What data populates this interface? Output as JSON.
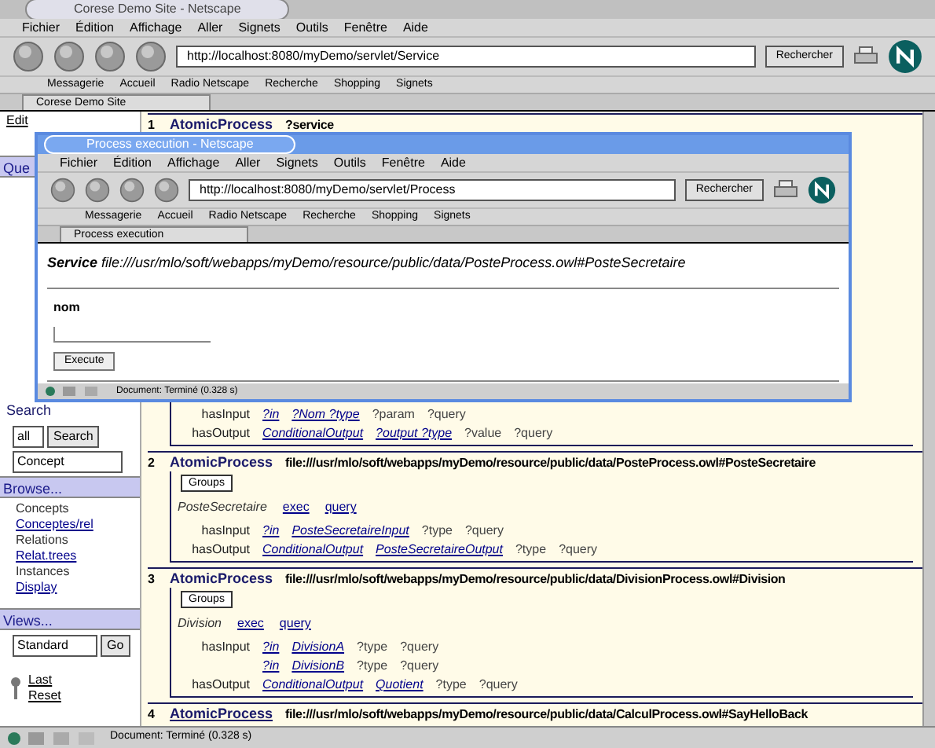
{
  "window": {
    "title": "Corese Demo Site - Netscape"
  },
  "menu": [
    "Fichier",
    "Édition",
    "Affichage",
    "Aller",
    "Signets",
    "Outils",
    "Fenêtre",
    "Aide"
  ],
  "address": {
    "value": "http://localhost:8080/myDemo/servlet/Service"
  },
  "search_button": "Rechercher",
  "bookmarks": [
    "Messagerie",
    "Accueil",
    "Radio Netscape",
    "Recherche",
    "Shopping",
    "Signets"
  ],
  "tab": {
    "label": "Corese Demo Site"
  },
  "sidebar": {
    "top_link": "Edit",
    "query_header": "Que",
    "search": {
      "header": "Search",
      "scope": "all",
      "button": "Search",
      "type": "Concept"
    },
    "browse": {
      "header": "Browse...",
      "items": [
        "Concepts",
        "Conceptes/rel",
        "Relations",
        "Relat.trees",
        "Instances",
        "Display"
      ]
    },
    "views": {
      "header": "Views...",
      "select": "Standard",
      "button": "Go"
    },
    "footer": [
      "Last",
      "Reset"
    ]
  },
  "results": [
    {
      "number": "1",
      "type": "AtomicProcess",
      "uri": "?service",
      "rows": [
        {
          "property": "hasInput",
          "values": [
            "?in",
            "?Nom ?type",
            "?param",
            "?query"
          ]
        },
        {
          "property": "hasOutput",
          "values": [
            "ConditionalOutput",
            "?output ?type",
            "?value",
            "?query"
          ]
        }
      ]
    },
    {
      "number": "2",
      "type": "AtomicProcess",
      "uri": "file:///usr/mlo/soft/webapps/myDemo/resource/public/data/PosteProcess.owl#PosteSecretaire",
      "group": "Groups",
      "name": "PosteSecretaire",
      "actions": [
        "exec",
        "query"
      ],
      "rows": [
        {
          "property": "hasInput",
          "values": [
            "?in",
            "PosteSecretaireInput",
            "?type",
            "?query"
          ]
        },
        {
          "property": "hasOutput",
          "values": [
            "ConditionalOutput",
            "PosteSecretaireOutput",
            "?type",
            "?query"
          ]
        }
      ]
    },
    {
      "number": "3",
      "type": "AtomicProcess",
      "uri": "file:///usr/mlo/soft/webapps/myDemo/resource/public/data/DivisionProcess.owl#Division",
      "group": "Groups",
      "name": "Division",
      "actions": [
        "exec",
        "query"
      ],
      "rows": [
        {
          "property": "hasInput",
          "values": [
            "?in",
            "DivisionA",
            "?type",
            "?query"
          ]
        },
        {
          "property": "",
          "values": [
            "?in",
            "DivisionB",
            "?type",
            "?query"
          ]
        },
        {
          "property": "hasOutput",
          "values": [
            "ConditionalOutput",
            "Quotient",
            "?type",
            "?query"
          ]
        }
      ]
    },
    {
      "number": "4",
      "type": "AtomicProcess",
      "uri": "file:///usr/mlo/soft/webapps/myDemo/resource/public/data/CalculProcess.owl#SayHelloBack"
    }
  ],
  "status": "Document: Terminé (0.328 s)",
  "popup": {
    "title": "Process execution - Netscape",
    "menu": [
      "Fichier",
      "Édition",
      "Affichage",
      "Aller",
      "Signets",
      "Outils",
      "Fenêtre",
      "Aide"
    ],
    "address": {
      "value": "http://localhost:8080/myDemo/servlet/Process"
    },
    "search_button": "Rechercher",
    "bookmarks": [
      "Messagerie",
      "Accueil",
      "Radio Netscape",
      "Recherche",
      "Shopping",
      "Signets"
    ],
    "tab": {
      "label": "Process execution"
    },
    "service_label": "Service",
    "service_uri": "file:///usr/mlo/soft/webapps/myDemo/resource/public/data/PosteProcess.owl#PosteSecretaire",
    "field": {
      "label": "nom"
    },
    "button": "Execute",
    "status": "Document: Terminé (0.328 s)"
  }
}
